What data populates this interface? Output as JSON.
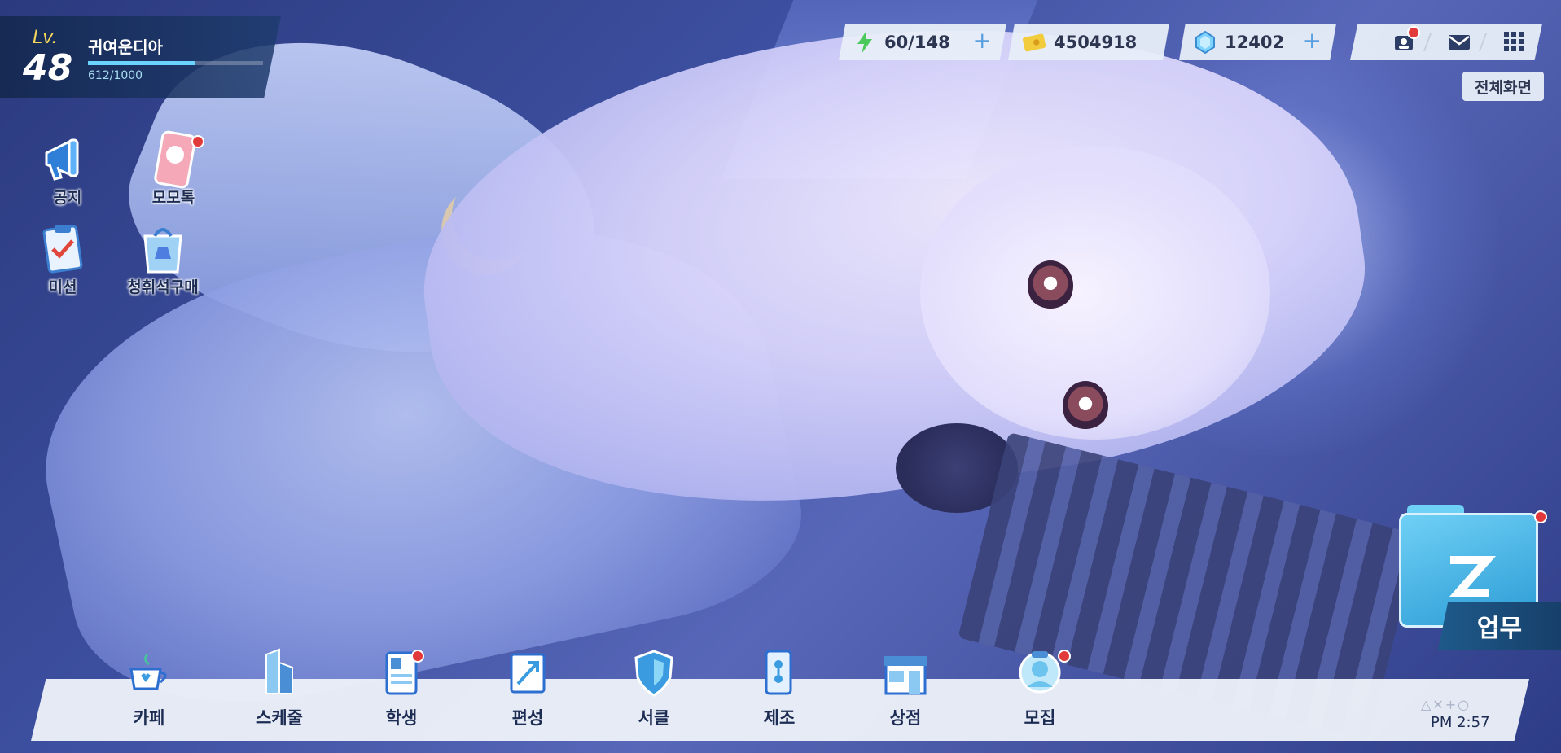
{
  "player": {
    "level_label": "Lv.",
    "level": "48",
    "name": "귀여운디아",
    "exp_text": "612/1000",
    "exp_fraction": 0.612
  },
  "resources": {
    "stamina": {
      "icon": "lightning-icon",
      "value": "60/148",
      "plus_label": "+"
    },
    "credits": {
      "icon": "credit-card-icon",
      "value": "4504918"
    },
    "gems": {
      "icon": "gem-icon",
      "value": "12402",
      "plus_label": "+"
    }
  },
  "top_menu": {
    "icons": [
      "friends-icon",
      "mail-icon",
      "grid-menu-icon"
    ],
    "fullscreen_label": "전체화면"
  },
  "quick_icons": [
    {
      "label": "공지",
      "icon": "megaphone-icon"
    },
    {
      "label": "모모톡",
      "icon": "phone-chat-icon"
    },
    {
      "label": "미션",
      "icon": "clipboard-check-icon"
    },
    {
      "label": "청휘석구매",
      "icon": "shopping-bag-icon"
    }
  ],
  "work_button": {
    "label": "업무",
    "icon": "folder-icon"
  },
  "nav": [
    {
      "label": "카페",
      "icon": "coffee-cup-icon"
    },
    {
      "label": "스케줄",
      "icon": "schedule-icon"
    },
    {
      "label": "학생",
      "icon": "student-card-icon"
    },
    {
      "label": "편성",
      "icon": "formation-icon"
    },
    {
      "label": "서클",
      "icon": "shield-icon"
    },
    {
      "label": "제조",
      "icon": "crafting-icon"
    },
    {
      "label": "상점",
      "icon": "shop-icon"
    },
    {
      "label": "모집",
      "icon": "recruit-icon"
    }
  ],
  "clock": {
    "deco": "△✕+○",
    "time": "PM 2:57"
  },
  "colors": {
    "accent": "#5aa0e0",
    "badge": "#e23a3a",
    "exp": "#6ad4ff",
    "level": "#f4d75b"
  }
}
